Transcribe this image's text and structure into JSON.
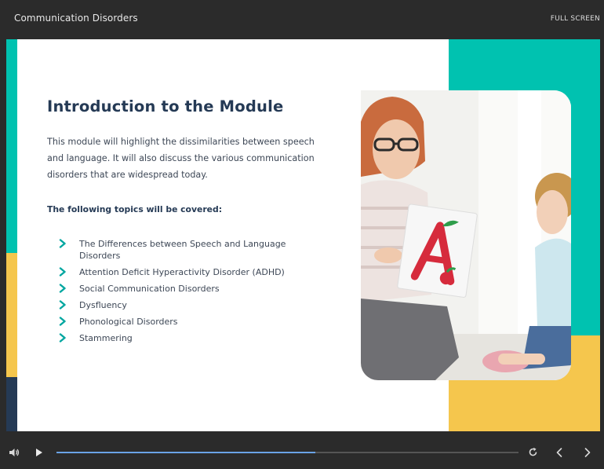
{
  "player": {
    "course_title": "Communication Disorders",
    "fullscreen_label": "FULL SCREEN",
    "progress_fraction": 0.56
  },
  "slide": {
    "title": "Introduction to the Module",
    "intro": "This module will highlight the dissimilarities between speech and language. It will also discuss the various communication disorders that are widespread today.",
    "topics_heading": "The following topics will be covered:",
    "topics": [
      "The Differences between Speech and Language Disorders",
      "Attention Deficit Hyperactivity Disorder (ADHD)",
      "Social Communication Disorders",
      "Dysfluency",
      "Phonological Disorders",
      "Stammering"
    ],
    "photo_card_letter": "A"
  },
  "colors": {
    "teal": "#00c2b0",
    "yellow": "#f5c64d",
    "navy": "#253a55",
    "chrome": "#2b2b2b",
    "progress": "#6aa3e6"
  },
  "icons": {
    "bullet": "chevron-right-icon",
    "volume": "volume-icon",
    "play": "play-icon",
    "replay": "replay-icon",
    "prev": "chevron-left-icon",
    "next": "chevron-right-icon"
  }
}
